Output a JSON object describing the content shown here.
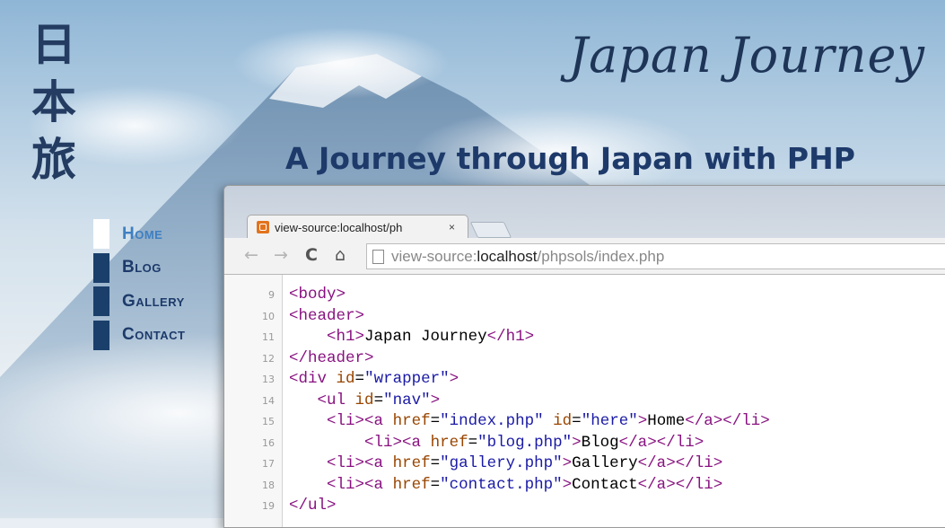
{
  "site": {
    "kanji": [
      "日",
      "本",
      "旅"
    ],
    "title": "Japan Journey",
    "tagline": "A Journey through Japan with PHP",
    "nav": [
      {
        "label": "Home",
        "current": true
      },
      {
        "label": "Blog",
        "current": false
      },
      {
        "label": "Gallery",
        "current": false
      },
      {
        "label": "Contact",
        "current": false
      }
    ]
  },
  "browser": {
    "tab_title": "view-source:localhost/ph",
    "tab_close": "×",
    "url_scheme": "view-source:",
    "url_host": "localhost",
    "url_path": "/phpsols/index.php"
  },
  "source_lines": [
    {
      "n": "9",
      "indent": 0,
      "code": "<body>"
    },
    {
      "n": "10",
      "indent": 0,
      "code": "<header>"
    },
    {
      "n": "11",
      "indent": 4,
      "code": "<h1>Japan Journey</h1>"
    },
    {
      "n": "12",
      "indent": 0,
      "code": "</header>"
    },
    {
      "n": "13",
      "indent": 0,
      "code": "<div id=\"wrapper\">"
    },
    {
      "n": "14",
      "indent": 3,
      "code": "<ul id=\"nav\">"
    },
    {
      "n": "15",
      "indent": 4,
      "code": "<li><a href=\"index.php\" id=\"here\">Home</a></li>"
    },
    {
      "n": "16",
      "indent": 8,
      "code": "<li><a href=\"blog.php\">Blog</a></li>"
    },
    {
      "n": "17",
      "indent": 4,
      "code": "<li><a href=\"gallery.php\">Gallery</a></li>"
    },
    {
      "n": "18",
      "indent": 4,
      "code": "<li><a href=\"contact.php\">Contact</a></li>"
    },
    {
      "n": "19",
      "indent": 0,
      "code": "</ul>"
    }
  ],
  "colors": {
    "site_title": "#1e3558",
    "nav_bar": "#1a3f6b",
    "nav_current": "#3f7fc1",
    "syntax_tag": "#881280",
    "syntax_attr": "#994500",
    "syntax_value": "#1a1aa6"
  },
  "icons": [
    "back-arrow-icon",
    "forward-arrow-icon",
    "reload-icon",
    "home-icon",
    "page-icon",
    "favicon-icon",
    "close-icon"
  ]
}
